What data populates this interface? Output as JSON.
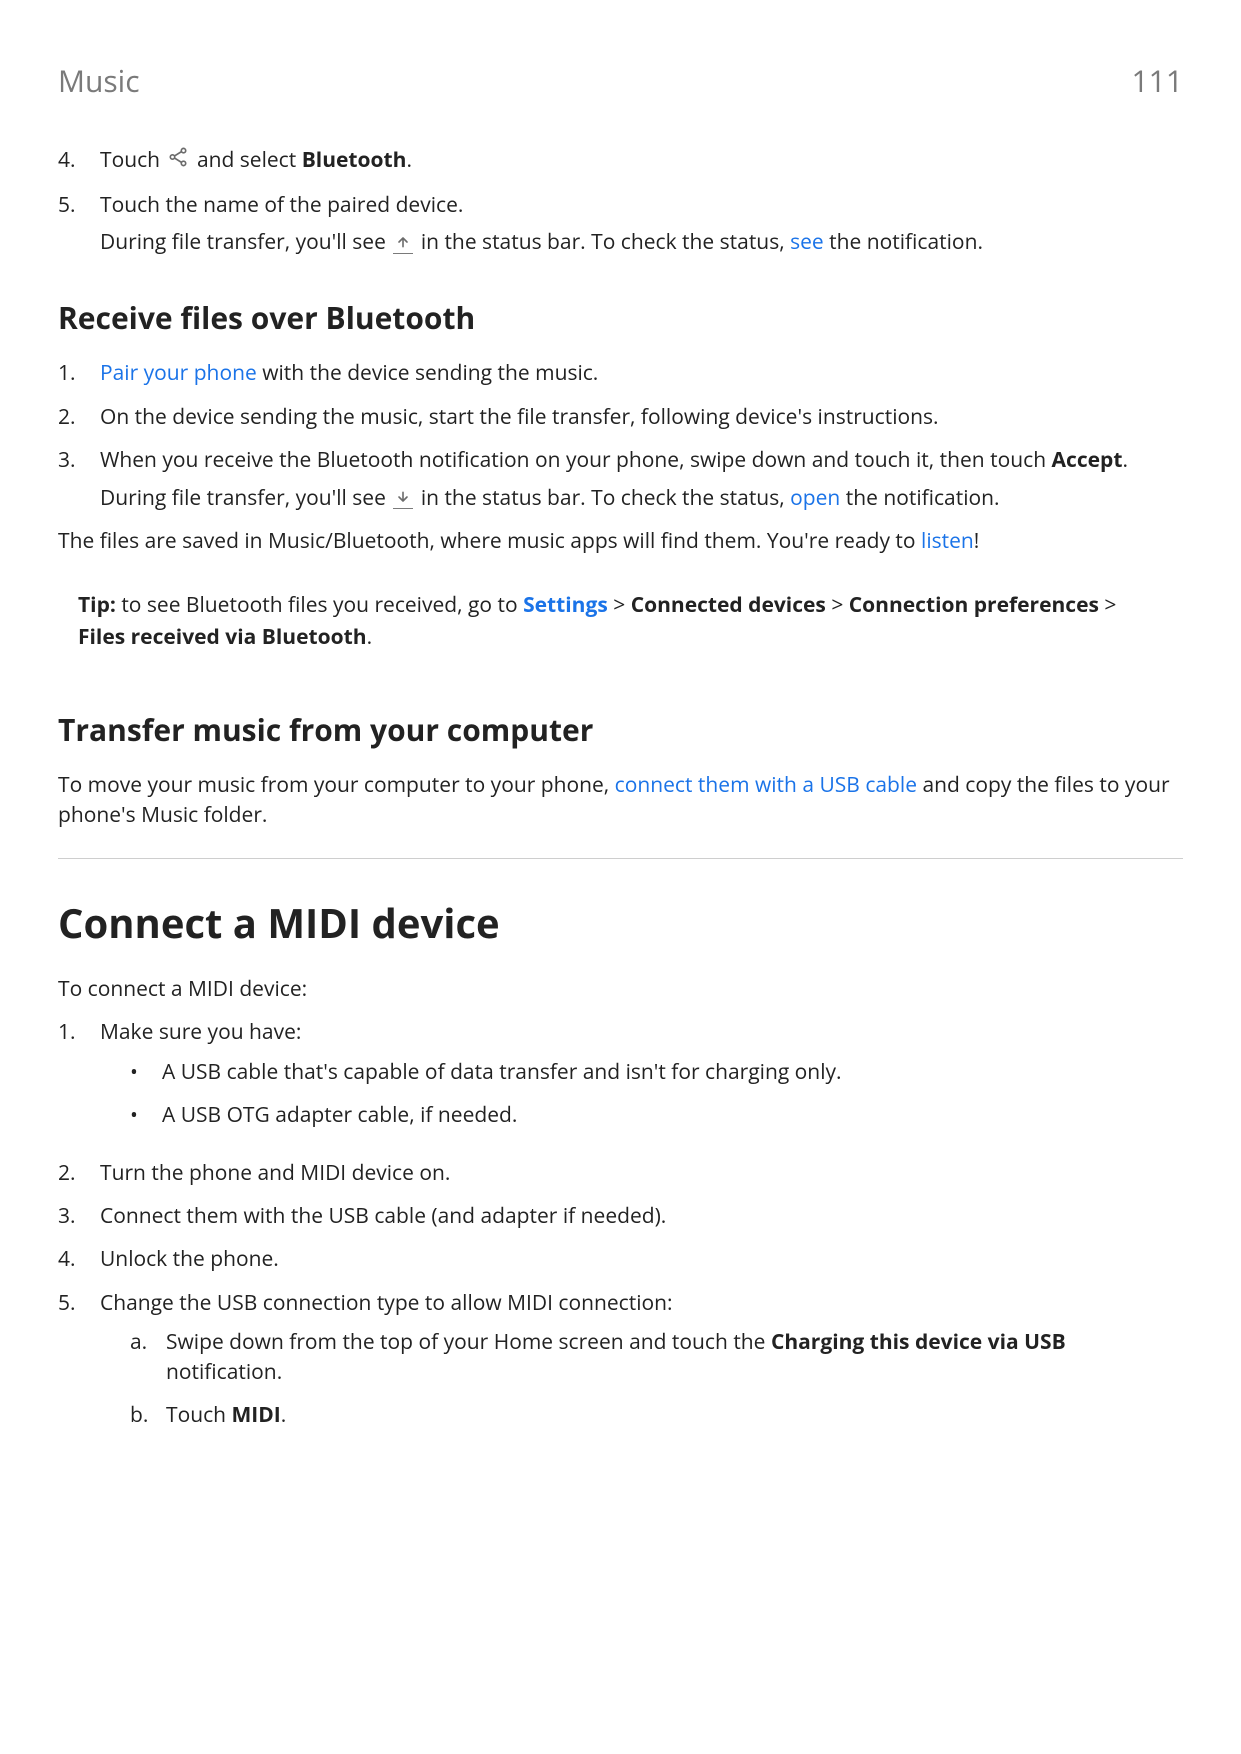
{
  "header": {
    "section": "Music",
    "page": "111"
  },
  "s1": {
    "i4": {
      "marker": "4.",
      "t_a": "Touch ",
      "t_b": " and select ",
      "bold": "Bluetooth",
      "t_c": "."
    },
    "i5": {
      "marker": "5.",
      "line1": "Touch the name of the paired device.",
      "sub_a": "During file transfer, you'll see ",
      "sub_b": " in the status bar. To check the status, ",
      "link": "see",
      "sub_c": " the notification."
    }
  },
  "receive": {
    "heading": "Receive files over Bluetooth",
    "i1": {
      "marker": "1.",
      "link": "Pair your phone",
      "rest": " with the device sending the music."
    },
    "i2": {
      "marker": "2.",
      "text": "On the device sending the music, start the file transfer, following device's instructions."
    },
    "i3": {
      "marker": "3.",
      "line_a": "When you receive the Bluetooth notification on your phone, swipe down and touch it, then touch ",
      "bold": "Accept",
      "line_b": ".",
      "sub_a": "During file transfer, you'll see ",
      "sub_b": " in the status bar. To check the status, ",
      "link": "open",
      "sub_c": " the notification."
    },
    "saved_a": "The files are saved in Music/Bluetooth, where music apps will find them. You're ready to ",
    "saved_link": "listen",
    "saved_b": "!",
    "tip_label": "Tip:",
    "tip_a": " to see Bluetooth files you received, go to ",
    "tip_link": "Settings",
    "tip_gt1": " > ",
    "tip_b1": "Connected devices",
    "tip_gt2": " > ",
    "tip_b2": "Connection preferences",
    "tip_gt3": " > ",
    "tip_b3": "Files received via Bluetooth",
    "tip_end": "."
  },
  "transfer": {
    "heading": "Transfer music from your computer",
    "p_a": "To move your music from your computer to your phone, ",
    "link": "connect them with a USB cable",
    "p_b": " and copy the files to your phone's Music folder."
  },
  "midi": {
    "heading": "Connect a MIDI device",
    "intro": "To connect a MIDI device:",
    "i1": {
      "marker": "1.",
      "text": "Make sure you have:",
      "b1": "A USB cable that's capable of data transfer and isn't for charging only.",
      "b2": "A USB OTG adapter cable, if needed."
    },
    "i2": {
      "marker": "2.",
      "text": "Turn the phone and MIDI device on."
    },
    "i3": {
      "marker": "3.",
      "text": "Connect them with the USB cable (and adapter if needed)."
    },
    "i4": {
      "marker": "4.",
      "text": "Unlock the phone."
    },
    "i5": {
      "marker": "5.",
      "text": "Change the USB connection type to allow MIDI connection:",
      "a": {
        "marker": "a.",
        "pre": "Swipe down from the top of your Home screen and touch the ",
        "bold": "Charging this device via USB",
        "post": " notification."
      },
      "b": {
        "marker": "b.",
        "pre": "Touch ",
        "bold": "MIDI",
        "post": "."
      }
    }
  },
  "bullet": "•"
}
